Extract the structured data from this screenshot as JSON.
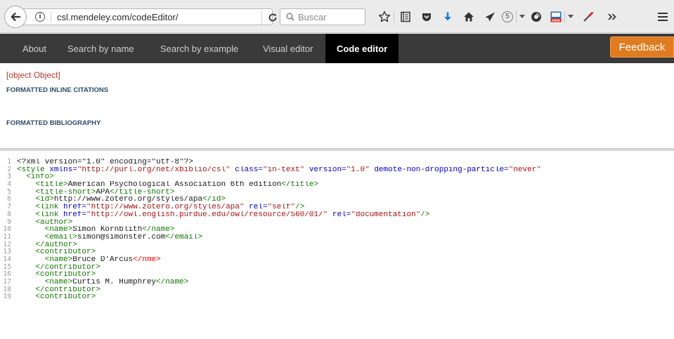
{
  "browser": {
    "url": "csl.mendeley.com/codeEditor/",
    "search_placeholder": "Buscar",
    "pocket_count": "5"
  },
  "nav": {
    "items": [
      {
        "label": "About",
        "active": false
      },
      {
        "label": "Search by name",
        "active": false
      },
      {
        "label": "Search by example",
        "active": false
      },
      {
        "label": "Visual editor",
        "active": false
      },
      {
        "label": "Code editor",
        "active": true
      }
    ],
    "feedback_label": "Feedback"
  },
  "output": {
    "error": "[object Object]",
    "inline_heading": "FORMATTED INLINE CITATIONS",
    "bibliography_heading": "FORMATTED BIBLIOGRAPHY"
  },
  "editor": {
    "lines": [
      [
        {
          "t": "text",
          "v": "<?xml version=\"1.0\" encoding=\"utf-8\"?>"
        }
      ],
      [
        {
          "t": "tag",
          "v": "<style "
        },
        {
          "t": "attr",
          "v": "xmlns="
        },
        {
          "t": "str",
          "v": "\"http://purl.org/net/xbiblio/csl\" "
        },
        {
          "t": "attr",
          "v": "class="
        },
        {
          "t": "str",
          "v": "\"in-text\" "
        },
        {
          "t": "attr",
          "v": "version="
        },
        {
          "t": "str",
          "v": "\"1.0\" "
        },
        {
          "t": "attr",
          "v": "demote-non-dropping-particle="
        },
        {
          "t": "str",
          "v": "\"never\""
        }
      ],
      [
        {
          "t": "text",
          "v": "  "
        },
        {
          "t": "tag",
          "v": "<info>"
        }
      ],
      [
        {
          "t": "text",
          "v": "    "
        },
        {
          "t": "tag",
          "v": "<title>"
        },
        {
          "t": "text",
          "v": "American Psychological Association 6th edition"
        },
        {
          "t": "tag",
          "v": "</title>"
        }
      ],
      [
        {
          "t": "text",
          "v": "    "
        },
        {
          "t": "tag",
          "v": "<title-short>"
        },
        {
          "t": "text",
          "v": "APA"
        },
        {
          "t": "tag",
          "v": "</title-short>"
        }
      ],
      [
        {
          "t": "text",
          "v": "    "
        },
        {
          "t": "tag",
          "v": "<id>"
        },
        {
          "t": "text",
          "v": "http://www.zotero.org/styles/apa"
        },
        {
          "t": "tag",
          "v": "</id>"
        }
      ],
      [
        {
          "t": "text",
          "v": "    "
        },
        {
          "t": "tag",
          "v": "<link "
        },
        {
          "t": "attr",
          "v": "href="
        },
        {
          "t": "str",
          "v": "\"http://www.zotero.org/styles/apa\" "
        },
        {
          "t": "attr",
          "v": "rel="
        },
        {
          "t": "str",
          "v": "\"self\""
        },
        {
          "t": "tag",
          "v": "/>"
        }
      ],
      [
        {
          "t": "text",
          "v": "    "
        },
        {
          "t": "tag",
          "v": "<link "
        },
        {
          "t": "attr",
          "v": "href="
        },
        {
          "t": "str",
          "v": "\"http://owl.english.purdue.edu/owl/resource/560/01/\" "
        },
        {
          "t": "attr",
          "v": "rel="
        },
        {
          "t": "str",
          "v": "\"documentation\""
        },
        {
          "t": "tag",
          "v": "/>"
        }
      ],
      [
        {
          "t": "text",
          "v": "    "
        },
        {
          "t": "tag",
          "v": "<author>"
        }
      ],
      [
        {
          "t": "text",
          "v": "      "
        },
        {
          "t": "tag",
          "v": "<name>"
        },
        {
          "t": "text",
          "v": "Simon Kornblith"
        },
        {
          "t": "tag",
          "v": "</name>"
        }
      ],
      [
        {
          "t": "text",
          "v": "      "
        },
        {
          "t": "tag",
          "v": "<email>"
        },
        {
          "t": "text",
          "v": "simon@simonster.com"
        },
        {
          "t": "tag",
          "v": "</email>"
        }
      ],
      [
        {
          "t": "text",
          "v": "    "
        },
        {
          "t": "tag",
          "v": "</author>"
        }
      ],
      [
        {
          "t": "text",
          "v": "    "
        },
        {
          "t": "tag",
          "v": "<contributor>"
        }
      ],
      [
        {
          "t": "text",
          "v": "      "
        },
        {
          "t": "tag",
          "v": "<name>"
        },
        {
          "t": "text",
          "v": "Bruce D'Arcus"
        },
        {
          "t": "err",
          "v": "</nme>"
        }
      ],
      [
        {
          "t": "text",
          "v": "    "
        },
        {
          "t": "tag",
          "v": "</contributor>"
        }
      ],
      [
        {
          "t": "text",
          "v": "    "
        },
        {
          "t": "tag",
          "v": "<contributor>"
        }
      ],
      [
        {
          "t": "text",
          "v": "      "
        },
        {
          "t": "tag",
          "v": "<name>"
        },
        {
          "t": "text",
          "v": "Curtis M. Humphrey"
        },
        {
          "t": "tag",
          "v": "</name>"
        }
      ],
      [
        {
          "t": "text",
          "v": "    "
        },
        {
          "t": "tag",
          "v": "</contributor>"
        }
      ],
      [
        {
          "t": "text",
          "v": "    "
        },
        {
          "t": "tag",
          "v": "<contributor>"
        }
      ]
    ]
  },
  "colors": {
    "nav_bg": "#3a3a3a",
    "nav_active_bg": "#000000",
    "feedback_bg": "#e07b1f",
    "error_text": "#c0392b",
    "heading_text": "#2b4b6b",
    "xml_tag": "#117700",
    "xml_attr": "#0000cc",
    "xml_string": "#aa1111",
    "xml_error": "#ff0000"
  },
  "icons": {
    "toolbar": [
      "star-icon",
      "reading-list-icon",
      "pocket-icon",
      "download-icon",
      "home-icon",
      "send-icon",
      "pocket-count-badge",
      "dropdown-icon",
      "recording-icon",
      "new-extension-icon",
      "dropdown-icon",
      "eyedropper-icon",
      "overflow-icon",
      "menu-icon"
    ]
  }
}
